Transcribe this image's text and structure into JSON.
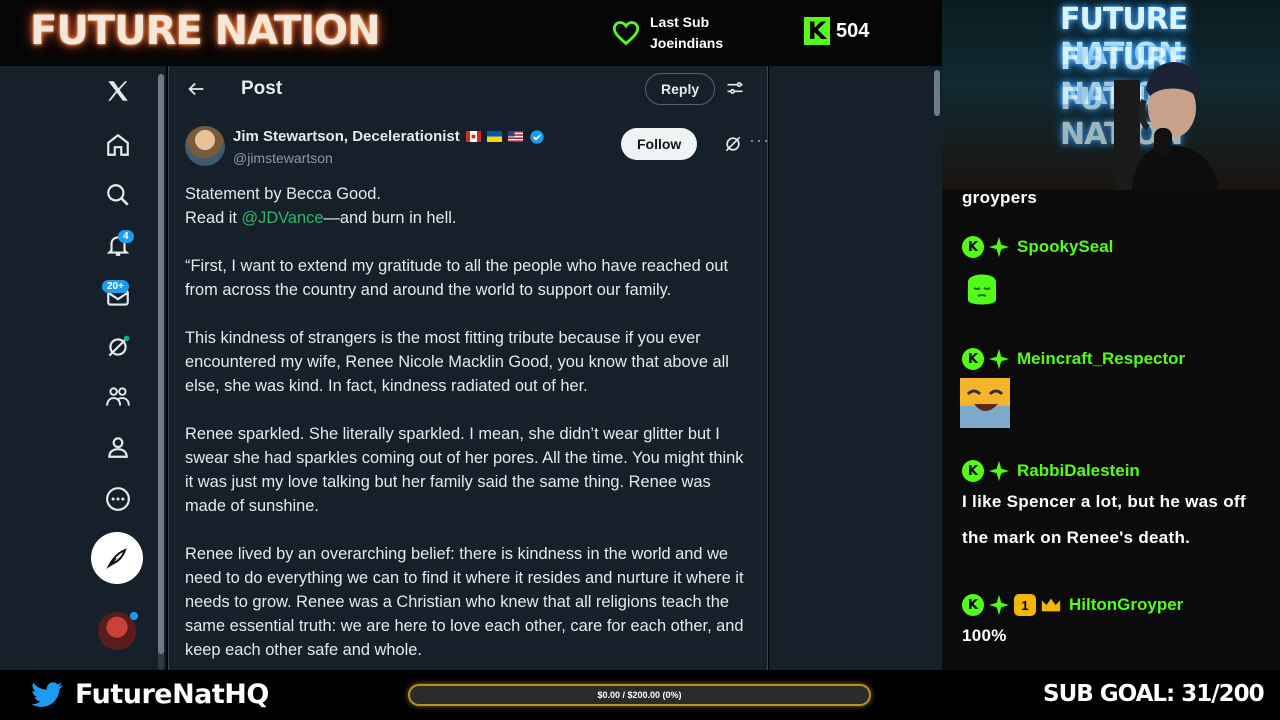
{
  "overlay": {
    "logo_text": "FUTURE NATION",
    "last_sub_label": "Last Sub",
    "last_sub_name": "Joeindians",
    "kick_count": "504",
    "twitter_handle": "FutureNatHQ",
    "goal_progress_text": "$0.00 / $200.00 (0%)",
    "goal_progress_fraction": 0,
    "sub_goal_text": "SUB GOAL: 31/200"
  },
  "xnav": {
    "notifications_badge": "4",
    "messages_badge": "20+"
  },
  "post": {
    "header_title": "Post",
    "reply_label": "Reply",
    "author_name": "Jim Stewartson, Decelerationist",
    "author_handle": "@jimstewartson",
    "follow_label": "Follow",
    "more_label": "···",
    "line1": "Statement by Becca Good.",
    "line2_prefix": "Read it ",
    "line2_mention": "@JDVance",
    "line2_suffix": "—and burn in hell.",
    "para1": "“First, I want to extend my gratitude to all the people who have reached out from across the country and around the world to support our family.",
    "para2": "This kindness of strangers is the most fitting tribute because if you ever encountered my wife, Renee Nicole Macklin Good, you know that above all else, she was kind. In fact, kindness radiated out of her.",
    "para3": "Renee sparkled. She literally sparkled. I mean, she didn’t wear glitter but I swear she had sparkles coming out of her pores. All the time. You might think it was just my love talking but her family said the same thing. Renee was made of sunshine.",
    "para4": "Renee lived by an overarching belief: there is kindness in the world and we need to do everything we can to find it where it resides and nurture it where it needs to grow. Renee was a Christian who knew that all religions teach the same essential truth: we are here to love each other, care for each other, and keep each other safe and whole."
  },
  "webcam": {
    "sign_line1": "FUTURE NATION",
    "sign_line2": "FUTURE NATION",
    "sign_line3": "FUTURE NATION"
  },
  "chat": {
    "partial_text": "groypers",
    "messages": [
      {
        "user": "SpookySeal",
        "text": ""
      },
      {
        "user": "Meincraft_Respector",
        "text": ""
      },
      {
        "user": "RabbiDalestein",
        "text": "I like Spencer a lot, but he was off the mark on Renee's death."
      },
      {
        "user": "HiltonGroyper",
        "text": "100%"
      }
    ],
    "badge_one": "1",
    "kick_badge": "K"
  },
  "colors": {
    "kick_green": "#53fc18",
    "x_bg": "#15202b",
    "x_blue": "#1d9bf0",
    "goal_border": "#b8902a"
  }
}
